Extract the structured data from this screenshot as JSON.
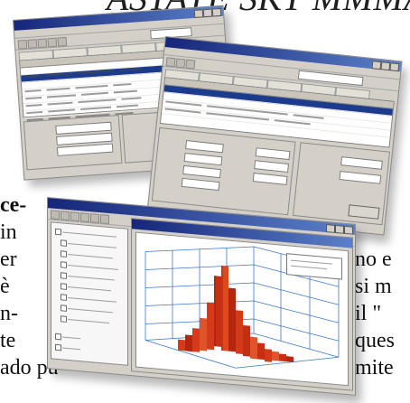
{
  "heading": {
    "text": "ASTATE SKY MMMAY"
  },
  "left_column": {
    "line1": "ce-",
    "line2": "in",
    "line3": "er",
    "line4": "è",
    "line5": "n-",
    "line6": "te",
    "line7": "ado pun"
  },
  "right_column": {
    "line1": "no e",
    "line2": "si m",
    "line3": "il \"",
    "line4": "ques",
    "line5": "mite"
  },
  "colors": {
    "titlebar": "#1f3a93",
    "window": "#d4d0c8",
    "bars": "#d33a1a",
    "selection": "#1c3b8c"
  },
  "icons": [
    "minimize-icon",
    "maximize-icon",
    "close-icon",
    "folder-icon",
    "save-icon",
    "print-icon"
  ]
}
